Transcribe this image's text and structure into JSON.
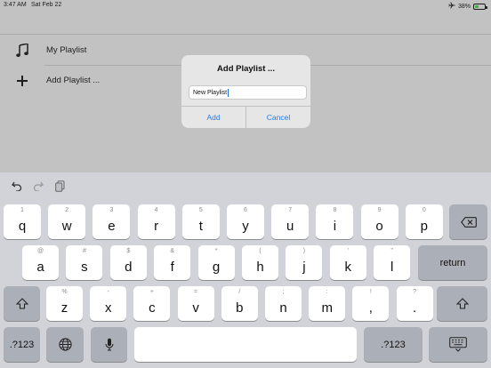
{
  "status_bar": {
    "time": "3:47 AM",
    "date": "Sat Feb 22",
    "battery_percent": "38%",
    "battery_level": 0.38,
    "airplane_icon": "airplane-icon"
  },
  "list": {
    "items": [
      {
        "icon": "music-note-icon",
        "label": "My Playlist"
      },
      {
        "icon": "plus-icon",
        "label": "Add Playlist ..."
      }
    ]
  },
  "dialog": {
    "title": "Add Playlist ...",
    "input_value": "New Playlist",
    "confirm_label": "Add",
    "cancel_label": "Cancel",
    "accent_color": "#2b7be3"
  },
  "keyboard": {
    "toolbar": {
      "undo_icon": "undo-icon",
      "redo_icon": "redo-icon",
      "paste_icon": "clipboard-icon"
    },
    "row1": [
      {
        "hint": "1",
        "main": "q"
      },
      {
        "hint": "2",
        "main": "w"
      },
      {
        "hint": "3",
        "main": "e"
      },
      {
        "hint": "4",
        "main": "r"
      },
      {
        "hint": "5",
        "main": "t"
      },
      {
        "hint": "6",
        "main": "y"
      },
      {
        "hint": "7",
        "main": "u"
      },
      {
        "hint": "8",
        "main": "i"
      },
      {
        "hint": "9",
        "main": "o"
      },
      {
        "hint": "0",
        "main": "p"
      }
    ],
    "row2": [
      {
        "hint": "@",
        "main": "a"
      },
      {
        "hint": "#",
        "main": "s"
      },
      {
        "hint": "$",
        "main": "d"
      },
      {
        "hint": "&",
        "main": "f"
      },
      {
        "hint": "*",
        "main": "g"
      },
      {
        "hint": "(",
        "main": "h"
      },
      {
        "hint": ")",
        "main": "j"
      },
      {
        "hint": "’",
        "main": "k"
      },
      {
        "hint": "\"",
        "main": "l"
      }
    ],
    "row3": [
      {
        "hint": "%",
        "main": "z"
      },
      {
        "hint": "-",
        "main": "x"
      },
      {
        "hint": "+",
        "main": "c"
      },
      {
        "hint": "=",
        "main": "v"
      },
      {
        "hint": "/",
        "main": "b"
      },
      {
        "hint": ";",
        "main": "n"
      },
      {
        "hint": ":",
        "main": "m"
      },
      {
        "hint": "!",
        "main": ","
      },
      {
        "hint": "?",
        "main": "."
      }
    ],
    "return_label": "return",
    "numbers_label": ".?123",
    "delete_icon": "delete-backward-icon",
    "shift_icon": "shift-icon",
    "globe_icon": "globe-icon",
    "mic_icon": "microphone-icon",
    "dismiss_icon": "keyboard-dismiss-icon"
  }
}
